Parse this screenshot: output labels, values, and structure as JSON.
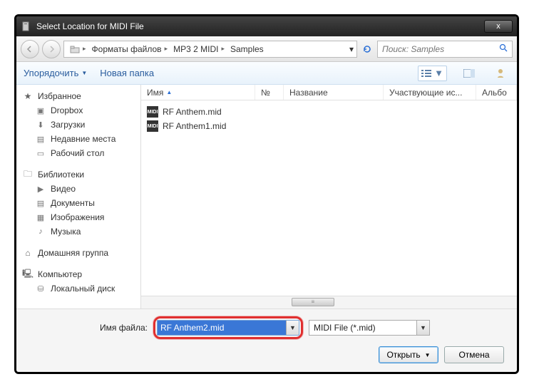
{
  "title": "Select Location for MIDI File",
  "close_label": "x",
  "path": {
    "seg1": "Форматы файлов",
    "seg2": "MP3 2 MIDI",
    "seg3": "Samples"
  },
  "search": {
    "placeholder": "Поиск: Samples"
  },
  "toolbar": {
    "organize": "Упорядочить",
    "newfolder": "Новая папка"
  },
  "sidebar": {
    "fav": {
      "head": "Избранное",
      "items": [
        "Dropbox",
        "Загрузки",
        "Недавние места",
        "Рабочий стол"
      ]
    },
    "lib": {
      "head": "Библиотеки",
      "items": [
        "Видео",
        "Документы",
        "Изображения",
        "Музыка"
      ]
    },
    "home": {
      "head": "Домашняя группа"
    },
    "comp": {
      "head": "Компьютер",
      "items": [
        "Локальный диск"
      ]
    }
  },
  "columns": {
    "name": "Имя",
    "num": "№",
    "nazv": "Название",
    "uch": "Участвующие ис...",
    "alb": "Альбо"
  },
  "files": [
    "RF Anthem.mid",
    "RF Anthem1.mid"
  ],
  "bottom": {
    "label": "Имя файла:",
    "value": "RF Anthem2.mid",
    "filter": "MIDI File (*.mid)",
    "open": "Открыть",
    "cancel": "Отмена"
  }
}
